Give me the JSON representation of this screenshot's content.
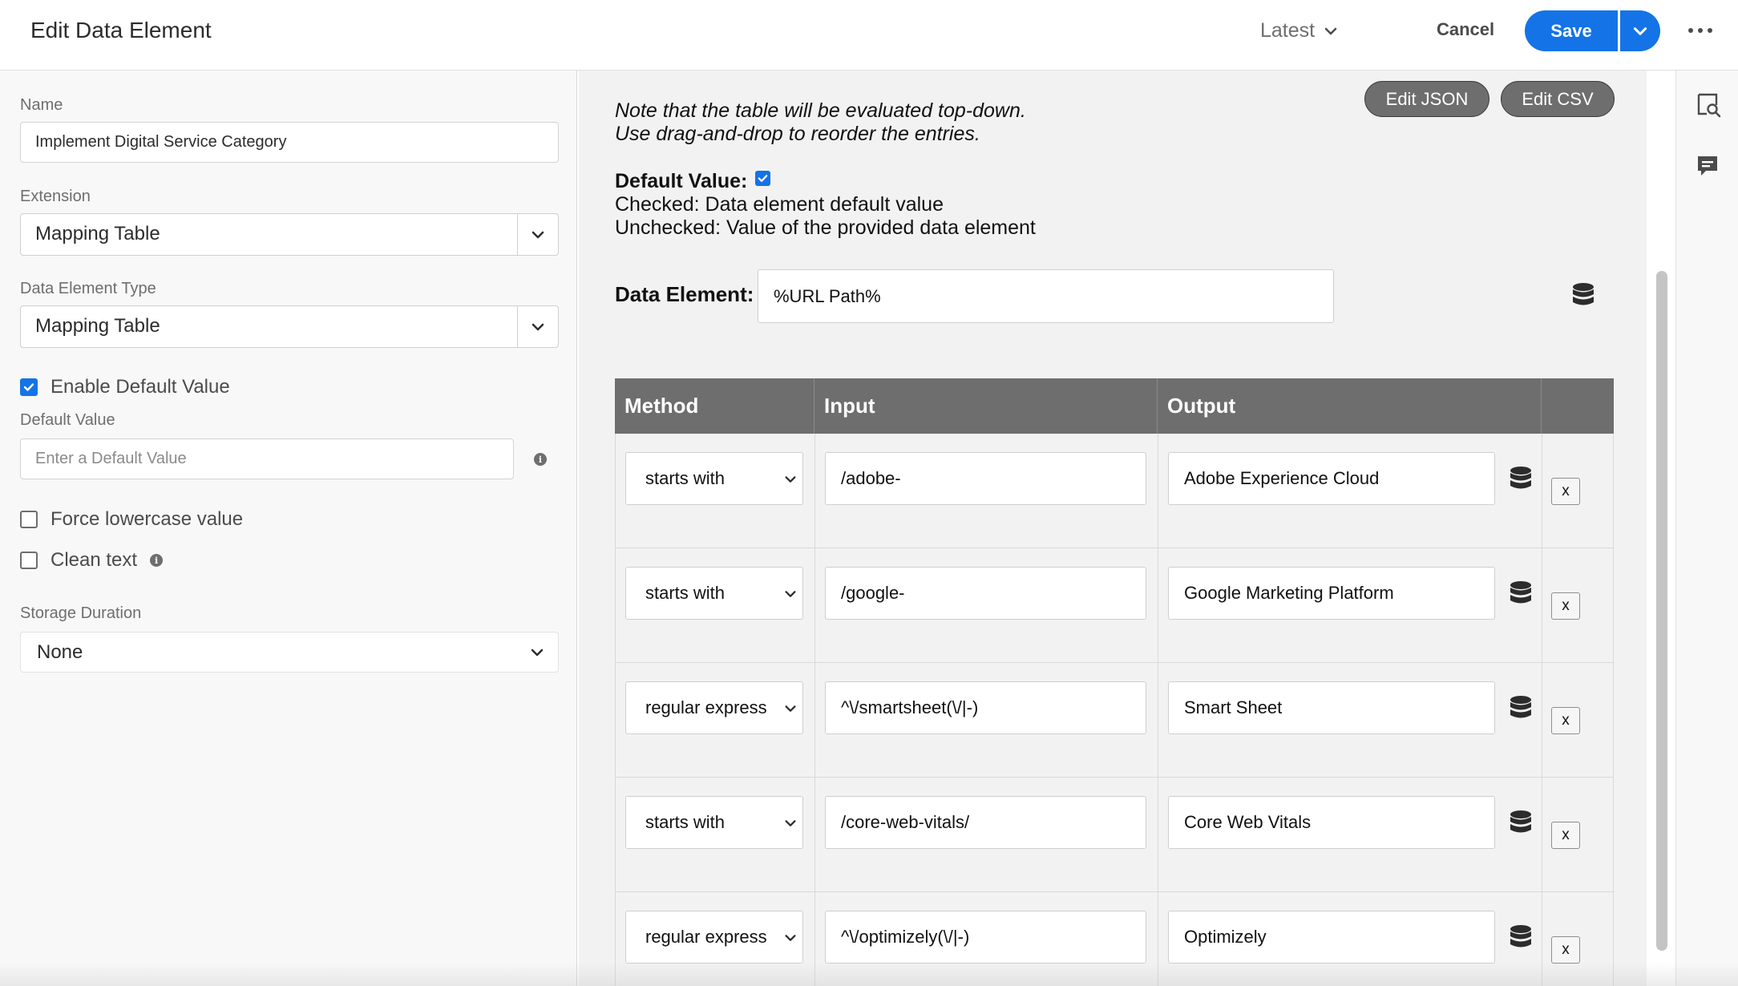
{
  "header": {
    "title": "Edit Data Element",
    "version_label": "Latest",
    "cancel_label": "Cancel",
    "save_label": "Save"
  },
  "form": {
    "name_label": "Name",
    "name_value": "Implement Digital Service Category",
    "extension_label": "Extension",
    "extension_value": "Mapping Table",
    "type_label": "Data Element Type",
    "type_value": "Mapping Table",
    "enable_default_label": "Enable Default Value",
    "enable_default_checked": true,
    "default_value_label": "Default Value",
    "default_value_placeholder": "Enter a Default Value",
    "force_lowercase_label": "Force lowercase value",
    "force_lowercase_checked": false,
    "clean_text_label": "Clean text",
    "clean_text_checked": false,
    "storage_label": "Storage Duration",
    "storage_value": "None"
  },
  "mapping": {
    "edit_json_label": "Edit JSON",
    "edit_csv_label": "Edit CSV",
    "note_line1": "Note that the table will be evaluated top-down.",
    "note_line2": "Use drag-and-drop to reorder the entries.",
    "default_value_heading": "Default Value:",
    "default_value_checked": true,
    "checked_desc": "Checked: Data element default value",
    "unchecked_desc": "Unchecked: Value of the provided data element",
    "data_element_label": "Data Element:",
    "data_element_value": "%URL Path%",
    "columns": [
      "Method",
      "Input",
      "Output"
    ],
    "rows": [
      {
        "method": "starts with",
        "input": "/adobe-",
        "output": "Adobe Experience Cloud"
      },
      {
        "method": "starts with",
        "input": "/google-",
        "output": "Google Marketing Platform"
      },
      {
        "method": "regular express",
        "input": "^\\/smartsheet(\\/|-)",
        "output": "Smart Sheet"
      },
      {
        "method": "starts with",
        "input": "/core-web-vitals/",
        "output": "Core Web Vitals"
      },
      {
        "method": "regular express",
        "input": "^\\/optimizely(\\/|-)",
        "output": "Optimizely"
      }
    ],
    "remove_label": "x"
  },
  "colors": {
    "accent": "#1473e6",
    "table_header": "#6e6e6e",
    "panel_bg": "#f2f2f2"
  },
  "icons": {
    "version_chevron": "chevron-down-icon",
    "more": "more-icon",
    "database": "database-icon",
    "rail_preview": "preview-icon",
    "rail_comments": "comment-icon"
  }
}
